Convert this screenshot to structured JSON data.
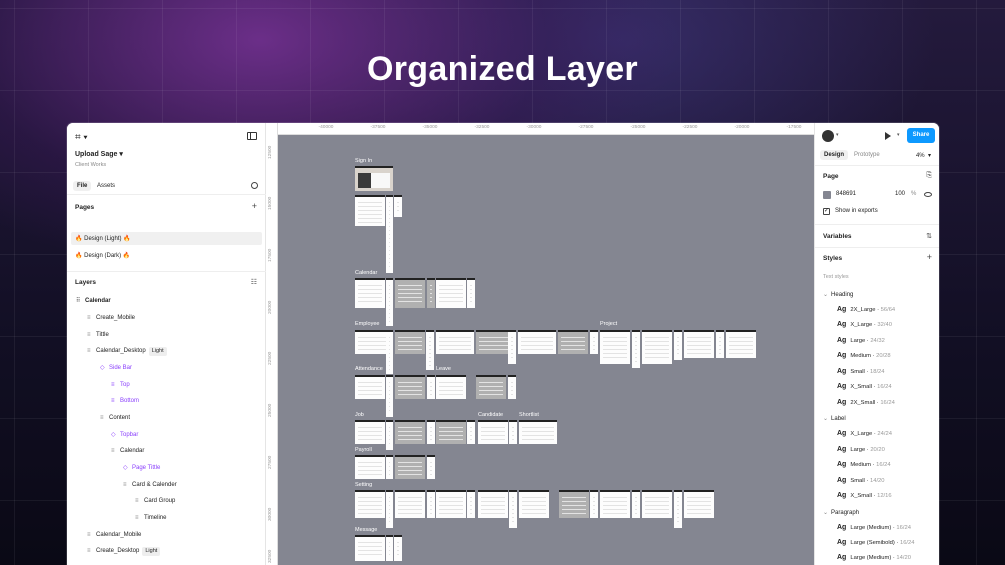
{
  "headline": "Organized Layer",
  "left_panel": {
    "project_name": "Upload Sage",
    "project_sub": "Client Works",
    "tabs": [
      "File",
      "Assets"
    ],
    "pages_title": "Pages",
    "pages": [
      "🔥 Design (Light) 🔥",
      "🔥 Design (Dark) 🔥"
    ],
    "layers_title": "Layers",
    "layers": [
      {
        "label": "Calendar",
        "chip": ""
      },
      {
        "label": "Create_Mobile",
        "chip": ""
      },
      {
        "label": "Tittle",
        "chip": ""
      },
      {
        "label": "Calendar_Desktop",
        "chip": "Light"
      },
      {
        "label": "Side Bar",
        "chip": ""
      },
      {
        "label": "Top",
        "chip": ""
      },
      {
        "label": "Bottom",
        "chip": ""
      },
      {
        "label": "Content",
        "chip": ""
      },
      {
        "label": "Topbar",
        "chip": ""
      },
      {
        "label": "Calendar",
        "chip": ""
      },
      {
        "label": "Page Tittle",
        "chip": ""
      },
      {
        "label": "Card & Calender",
        "chip": ""
      },
      {
        "label": "Card Group",
        "chip": ""
      },
      {
        "label": "Timeline",
        "chip": ""
      },
      {
        "label": "Calendar_Mobile",
        "chip": ""
      },
      {
        "label": "Create_Desktop",
        "chip": "Light"
      }
    ]
  },
  "canvas": {
    "ruler_top": [
      "-40000",
      "-37500",
      "-35000",
      "-32500",
      "-30000",
      "-27500",
      "-25000",
      "-22500",
      "-20000",
      "-17500"
    ],
    "ruler_left": [
      "12500",
      "15000",
      "17500",
      "20000",
      "22500",
      "25000",
      "27500",
      "30000",
      "32500"
    ],
    "frame_labels": [
      "Sign In",
      "Calendar",
      "Employee",
      "Project",
      "Attendance",
      "Leave",
      "Job",
      "Candidate",
      "Shortlist",
      "Payroll",
      "Setting",
      "Message"
    ]
  },
  "right_panel": {
    "tabs": [
      "Design",
      "Prototype"
    ],
    "zoom": "4%",
    "share_label": "Share",
    "page_title": "Page",
    "page_color_hex": "848691",
    "page_color": "#848691",
    "page_opacity": "100",
    "percent_symbol": "%",
    "show_in_exports": "Show in exports",
    "variables_title": "Variables",
    "styles_title": "Styles",
    "text_styles_label": "Text styles",
    "groups": [
      {
        "name": "Heading",
        "items": [
          {
            "name": "2X_Large",
            "size": "56/64"
          },
          {
            "name": "X_Large",
            "size": "32/40"
          },
          {
            "name": "Large",
            "size": "24/32"
          },
          {
            "name": "Medium",
            "size": "20/28"
          },
          {
            "name": "Small",
            "size": "18/24"
          },
          {
            "name": "X_Small",
            "size": "16/24"
          },
          {
            "name": "2X_Small",
            "size": "16/24"
          }
        ]
      },
      {
        "name": "Label",
        "items": [
          {
            "name": "X_Large",
            "size": "24/24"
          },
          {
            "name": "Large",
            "size": "20/20"
          },
          {
            "name": "Medium",
            "size": "16/24"
          },
          {
            "name": "Small",
            "size": "14/20"
          },
          {
            "name": "X_Small",
            "size": "12/16"
          }
        ]
      },
      {
        "name": "Paragraph",
        "items": [
          {
            "name": "Large (Medium)",
            "size": "16/24"
          },
          {
            "name": "Large (Semibold)",
            "size": "16/24"
          },
          {
            "name": "Large (Medium)",
            "size": "14/20"
          }
        ]
      }
    ],
    "ag_glyph": "Ag"
  }
}
